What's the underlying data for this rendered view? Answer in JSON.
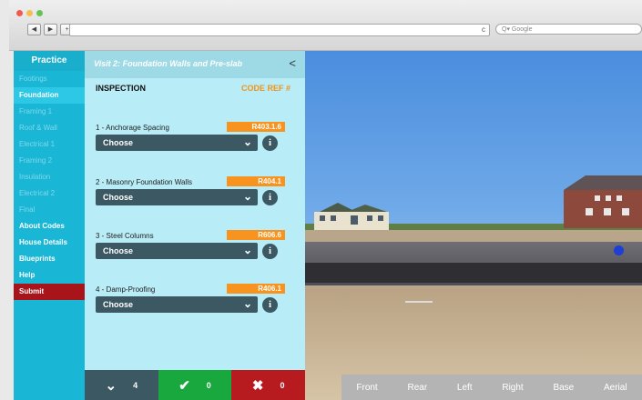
{
  "browser": {
    "search_placeholder": "Google",
    "reload_glyph": "c",
    "back_glyph": "◀",
    "forward_glyph": "▶",
    "plus_glyph": "+"
  },
  "nav": {
    "title": "Practice",
    "items": [
      {
        "label": "Footings",
        "state": "faded"
      },
      {
        "label": "Foundation",
        "state": "active"
      },
      {
        "label": "Framing 1",
        "state": "faded"
      },
      {
        "label": "Roof & Wall",
        "state": "faded"
      },
      {
        "label": "Electrical 1",
        "state": "faded"
      },
      {
        "label": "Framing 2",
        "state": "faded"
      },
      {
        "label": "Insulation",
        "state": "faded"
      },
      {
        "label": "Electrical 2",
        "state": "faded"
      },
      {
        "label": "Final",
        "state": "faded"
      },
      {
        "label": "About Codes",
        "state": "bold"
      },
      {
        "label": "House Details",
        "state": "bold"
      },
      {
        "label": "Blueprints",
        "state": "bold"
      },
      {
        "label": "Help",
        "state": "bold"
      },
      {
        "label": "Submit",
        "state": "submit"
      }
    ]
  },
  "panel": {
    "visit_title": "Visit 2: Foundation Walls and Pre-slab",
    "collapse_glyph": "<",
    "inspection_heading": "INSPECTION",
    "code_ref_heading": "CODE REF #",
    "items": [
      {
        "label": "1 - Anchorage Spacing",
        "ref": "R403.1.6",
        "value": "Choose"
      },
      {
        "label": "2 - Masonry Foundation Walls",
        "ref": "R404.1",
        "value": "Choose"
      },
      {
        "label": "3 - Steel Columns",
        "ref": "R606.6",
        "value": "Choose"
      },
      {
        "label": "4 - Damp-Proofing",
        "ref": "R406.1",
        "value": "Choose"
      }
    ]
  },
  "footer": {
    "pending_count": "4",
    "pass_count": "0",
    "fail_count": "0"
  },
  "viewbar": {
    "buttons": [
      "Front",
      "Rear",
      "Left",
      "Right",
      "Base",
      "Aerial"
    ]
  },
  "colors": {
    "nav_bg": "#1ab6d6",
    "panel_bg": "#b8ecf6",
    "ref_badge": "#f7931e",
    "select_bg": "#3c5863",
    "pass": "#18a83d",
    "fail": "#b71b20"
  }
}
